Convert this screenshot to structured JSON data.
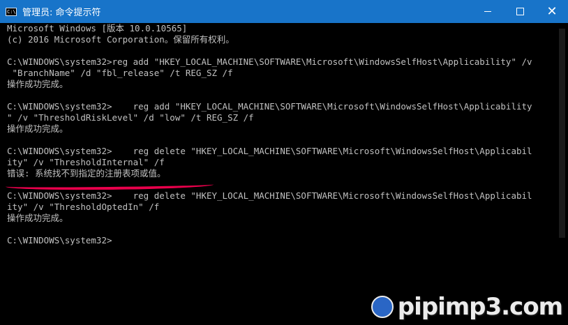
{
  "window": {
    "title": "管理员: 命令提示符",
    "icon_label": "C:\\",
    "controls": {
      "minimize": "minimize",
      "maximize": "maximize",
      "close": "✕"
    }
  },
  "console_lines": [
    "Microsoft Windows [版本 10.0.10565]",
    "(c) 2016 Microsoft Corporation。保留所有权利。",
    "",
    "C:\\WINDOWS\\system32>reg add \"HKEY_LOCAL_MACHINE\\SOFTWARE\\Microsoft\\WindowsSelfHost\\Applicability\" /v",
    " \"BranchName\" /d \"fbl_release\" /t REG_SZ /f",
    "操作成功完成。",
    "",
    "C:\\WINDOWS\\system32>    reg add \"HKEY_LOCAL_MACHINE\\SOFTWARE\\Microsoft\\WindowsSelfHost\\Applicability",
    "\" /v \"ThresholdRiskLevel\" /d \"low\" /t REG_SZ /f",
    "操作成功完成。",
    "",
    "C:\\WINDOWS\\system32>    reg delete \"HKEY_LOCAL_MACHINE\\SOFTWARE\\Microsoft\\WindowsSelfHost\\Applicabil",
    "ity\" /v \"ThresholdInternal\" /f",
    "错误: 系统找不到指定的注册表项或值。",
    "",
    "C:\\WINDOWS\\system32>    reg delete \"HKEY_LOCAL_MACHINE\\SOFTWARE\\Microsoft\\WindowsSelfHost\\Applicabil",
    "ity\" /v \"ThresholdOptedIn\" /f",
    "操作成功完成。",
    "",
    "C:\\WINDOWS\\system32>"
  ],
  "watermark": {
    "text": "pipimp3.com"
  },
  "colors": {
    "titlebar": "#1874c9",
    "console_bg": "#000000",
    "console_text": "#c0c0c0",
    "highlight": "#e8004b"
  }
}
